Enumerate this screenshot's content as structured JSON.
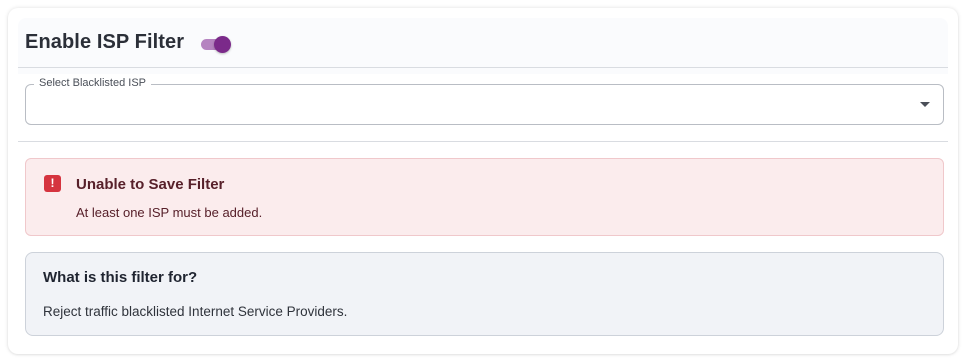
{
  "header": {
    "title": "Enable ISP Filter",
    "toggle": {
      "checked": true,
      "color": "#7b2a8a"
    }
  },
  "isp_select": {
    "label": "Select Blacklisted ISP",
    "value": ""
  },
  "alert": {
    "icon": "exclamation-icon",
    "title": "Unable to Save Filter",
    "message": "At least one ISP must be added.",
    "color": "#d5343f"
  },
  "info": {
    "title": "What is this filter for?",
    "text": "Reject traffic blacklisted Internet Service Providers."
  }
}
